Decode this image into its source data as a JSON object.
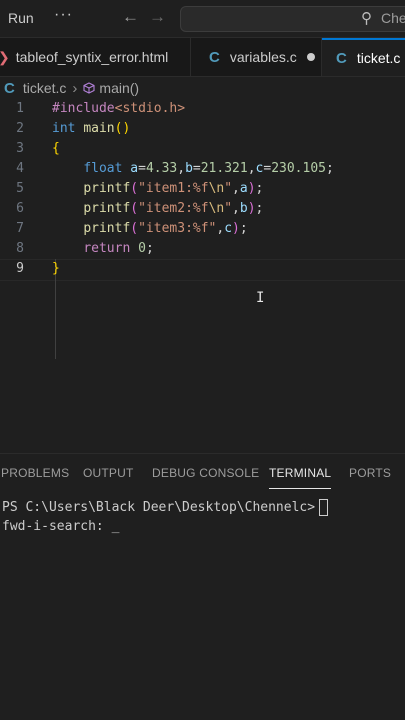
{
  "titlebar": {
    "run_label": "Run",
    "more_glyph": "···",
    "back_glyph": "←",
    "forward_glyph": "→",
    "search_text": "Che"
  },
  "tabs": [
    {
      "label": "tableof_syntix_error.html",
      "icon": "html-arrow-icon"
    },
    {
      "label": "variables.c",
      "icon": "c-file-icon",
      "modified": true
    },
    {
      "label": "ticket.c",
      "icon": "c-file-icon",
      "active": true
    }
  ],
  "breadcrumb": {
    "file": "ticket.c",
    "symbol": "main()"
  },
  "editor": {
    "line_numbers": [
      "1",
      "2",
      "3",
      "4",
      "5",
      "6",
      "7",
      "8",
      "9"
    ],
    "lines": [
      {
        "parts": [
          [
            "#include",
            "t-inc"
          ],
          [
            "<stdio.h>",
            "t-hdr"
          ]
        ]
      },
      {
        "parts": [
          [
            "int",
            "t-kw"
          ],
          [
            " ",
            "t-plain"
          ],
          [
            "main",
            "t-fn"
          ],
          [
            "()",
            "t-br"
          ]
        ]
      },
      {
        "parts": [
          [
            "{",
            "t-br"
          ]
        ]
      },
      {
        "parts": [
          [
            "    ",
            "t-plain"
          ],
          [
            "float",
            "t-kw"
          ],
          [
            " ",
            "t-plain"
          ],
          [
            "a",
            "t-var"
          ],
          [
            "=",
            "t-plain"
          ],
          [
            "4.33",
            "t-num"
          ],
          [
            ",",
            "t-plain"
          ],
          [
            "b",
            "t-var"
          ],
          [
            "=",
            "t-plain"
          ],
          [
            "21.321",
            "t-num"
          ],
          [
            ",",
            "t-plain"
          ],
          [
            "c",
            "t-var"
          ],
          [
            "=",
            "t-plain"
          ],
          [
            "230.105",
            "t-num"
          ],
          [
            ";",
            "t-plain"
          ]
        ]
      },
      {
        "parts": [
          [
            "    ",
            "t-plain"
          ],
          [
            "printf",
            "t-fn"
          ],
          [
            "(",
            "t-br2"
          ],
          [
            "\"item1:%f",
            "t-str"
          ],
          [
            "\\n",
            "t-esc"
          ],
          [
            "\"",
            "t-str"
          ],
          [
            ",",
            "t-plain"
          ],
          [
            "a",
            "t-var"
          ],
          [
            ")",
            "t-br2"
          ],
          [
            ";",
            "t-plain"
          ]
        ]
      },
      {
        "parts": [
          [
            "    ",
            "t-plain"
          ],
          [
            "printf",
            "t-fn"
          ],
          [
            "(",
            "t-br2"
          ],
          [
            "\"item2:%f",
            "t-str"
          ],
          [
            "\\n",
            "t-esc"
          ],
          [
            "\"",
            "t-str"
          ],
          [
            ",",
            "t-plain"
          ],
          [
            "b",
            "t-var"
          ],
          [
            ")",
            "t-br2"
          ],
          [
            ";",
            "t-plain"
          ]
        ]
      },
      {
        "parts": [
          [
            "    ",
            "t-plain"
          ],
          [
            "printf",
            "t-fn"
          ],
          [
            "(",
            "t-br2"
          ],
          [
            "\"item3:%f\"",
            "t-str"
          ],
          [
            ",",
            "t-plain"
          ],
          [
            "c",
            "t-var"
          ],
          [
            ")",
            "t-br2"
          ],
          [
            ";",
            "t-plain"
          ]
        ]
      },
      {
        "parts": [
          [
            "    ",
            "t-plain"
          ],
          [
            "return",
            "t-ctl"
          ],
          [
            " ",
            "t-plain"
          ],
          [
            "0",
            "t-num"
          ],
          [
            ";",
            "t-plain"
          ]
        ]
      },
      {
        "parts": [
          [
            "}",
            "t-br"
          ]
        ]
      }
    ],
    "active_line": 9
  },
  "panel": {
    "tabs": [
      "PROBLEMS",
      "OUTPUT",
      "DEBUG CONSOLE",
      "TERMINAL",
      "PORTS"
    ],
    "active_tab": "TERMINAL"
  },
  "terminal": {
    "prompt": "PS C:\\Users\\Black Deer\\Desktop\\Chennelc>",
    "search_line": "fwd-i-search: _"
  },
  "colors": {
    "accent": "#0078d4",
    "background": "#1f1f1f"
  }
}
